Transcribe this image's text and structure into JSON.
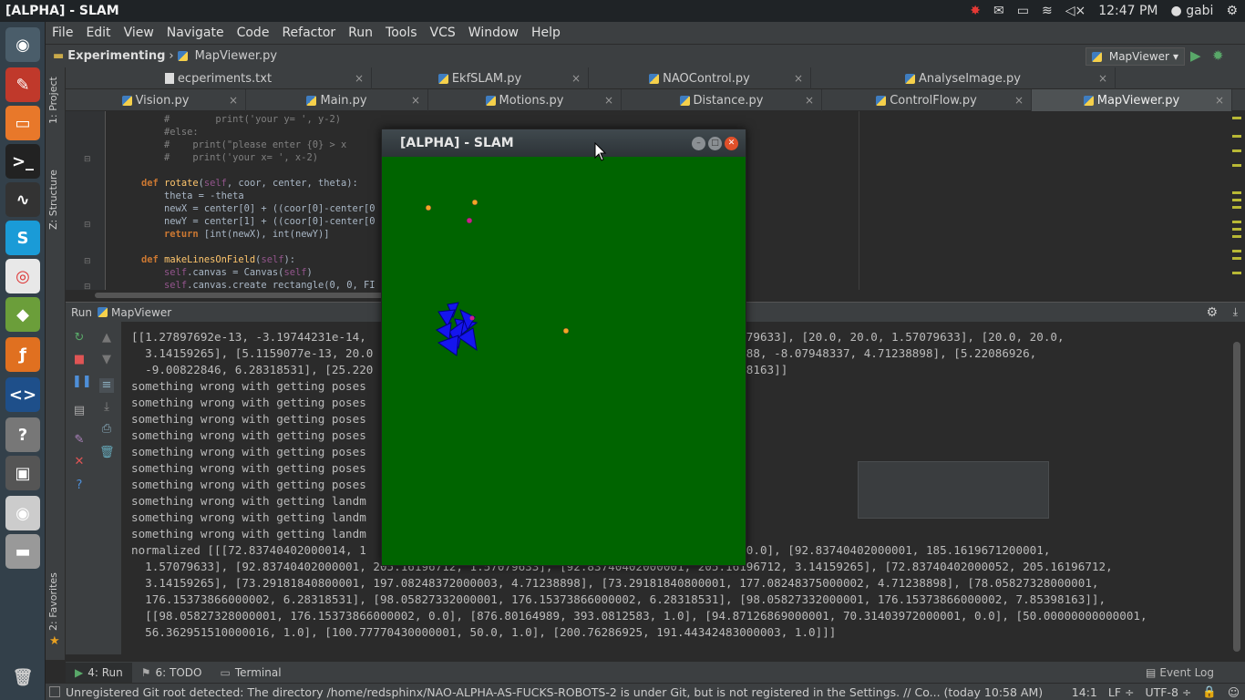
{
  "window_title": "[ALPHA] - SLAM",
  "tray": {
    "clock": "12:47 PM",
    "user": "gabi"
  },
  "launcher": [
    {
      "name": "dash",
      "color": "#4a5d6a",
      "glyph": "◉"
    },
    {
      "name": "pycharm",
      "color": "#c0392b",
      "glyph": "✎"
    },
    {
      "name": "files",
      "color": "#e8782a",
      "glyph": "▭"
    },
    {
      "name": "terminal",
      "color": "#222",
      "glyph": ">_"
    },
    {
      "name": "monitor",
      "color": "#333",
      "glyph": "∿"
    },
    {
      "name": "skype",
      "color": "#1a9bd7",
      "glyph": "S"
    },
    {
      "name": "chrome",
      "color": "#e8e8e8",
      "glyph": "◎"
    },
    {
      "name": "android",
      "color": "#6b9e3a",
      "glyph": "◆"
    },
    {
      "name": "matlab",
      "color": "#e07020",
      "glyph": "ƒ"
    },
    {
      "name": "codeblocks",
      "color": "#1e4f8a",
      "glyph": "<>"
    },
    {
      "name": "help",
      "color": "#777",
      "glyph": "?"
    },
    {
      "name": "screen",
      "color": "#555",
      "glyph": "▣"
    },
    {
      "name": "disc",
      "color": "#ccc",
      "glyph": "◉"
    },
    {
      "name": "drive",
      "color": "#999",
      "glyph": "▬"
    }
  ],
  "menu": [
    "File",
    "Edit",
    "View",
    "Navigate",
    "Code",
    "Refactor",
    "Run",
    "Tools",
    "VCS",
    "Window",
    "Help"
  ],
  "breadcrumb": {
    "project": "Experimenting",
    "file": "MapViewer.py"
  },
  "run_config": "MapViewer",
  "side_labels": {
    "project": "1: Project",
    "structure": "Z: Structure",
    "favorites": "2: Favorites"
  },
  "tabs_row1": [
    "ecperiments.txt",
    "EkfSLAM.py",
    "NAOControl.py",
    "AnalyseImage.py"
  ],
  "tabs_row2": [
    "Vision.py",
    "Main.py",
    "Motions.py",
    "Distance.py",
    "ControlFlow.py",
    "MapViewer.py"
  ],
  "run_panel": {
    "title": "Run",
    "config": "MapViewer"
  },
  "console": [
    "[[1.27897692e-13, -3.19744231e-14,                                        0873e-14, 1.57079633], [20.0, 20.0, 1.57079633], [20.0, 20.0,",
    "  3.14159265], [5.1159077e-13, 20.0                                        8], [0.454414388, -8.07948337, 4.71238898], [5.22086926,",
    "  -9.00822846, 6.28318531], [25.220                                        822846, 7.85398163]]",
    "something wrong with getting poses",
    "something wrong with getting poses",
    "something wrong with getting poses",
    "something wrong with getting poses",
    "something wrong with getting poses",
    "something wrong with getting poses",
    "something wrong with getting poses",
    "something wrong with getting landm",
    "something wrong with getting landm",
    "something wrong with getting landm",
    "normalized [[[72.83740402000014, 1                                        1619671199999, 0.0], [92.83740402000001, 185.1619671200001,",
    "  1.57079633], [92.83740402000001, 205.16196712, 1.57079633], [92.83740402000001, 205.16196712, 3.14159265], [72.83740402000052, 205.16196712,",
    "  3.14159265], [73.29181840800001, 197.08248372000003, 4.71238898], [73.29181840800001, 177.08248375000002, 4.71238898], [78.05827328000001,",
    "  176.15373866000002, 6.28318531], [98.05827332000001, 176.15373866000002, 6.28318531], [98.05827332000001, 176.15373866000002, 7.85398163]],",
    "  [[98.05827328000001, 176.15373866000002, 0.0], [876.80164989, 393.0812583, 1.0], [94.87126869000001, 70.31403972000001, 0.0], [50.00000000000001,",
    "  56.362951510000016, 1.0], [100.77770430000001, 50.0, 1.0], [200.76286925, 191.44342483000003, 1.0]]]"
  ],
  "bottom_tabs": [
    {
      "num": "4",
      "label": "Run",
      "icon": "run-icon"
    },
    {
      "num": "6",
      "label": "TODO",
      "icon": "todo-icon"
    },
    {
      "num": "",
      "label": "Terminal",
      "icon": "terminal-icon"
    }
  ],
  "event_log": "Event Log",
  "status": {
    "message": "Unregistered Git root detected: The directory /home/redsphinx/NAO-ALPHA-AS-FUCKS-ROBOTS-2 is under Git, but is not registered in the Settings. // Co... (today 10:58 AM)",
    "position": "14:1",
    "line_sep": "LF",
    "encoding": "UTF-8"
  },
  "tk_window": {
    "title": "[ALPHA] - SLAM",
    "field_color": "#006400"
  },
  "field_landmarks": [
    {
      "kind": "orange",
      "color": "#f5a623"
    },
    {
      "kind": "orange",
      "color": "#f5a623"
    },
    {
      "kind": "magenta",
      "color": "#cc1f8a"
    },
    {
      "kind": "orange",
      "color": "#f5a623"
    }
  ]
}
